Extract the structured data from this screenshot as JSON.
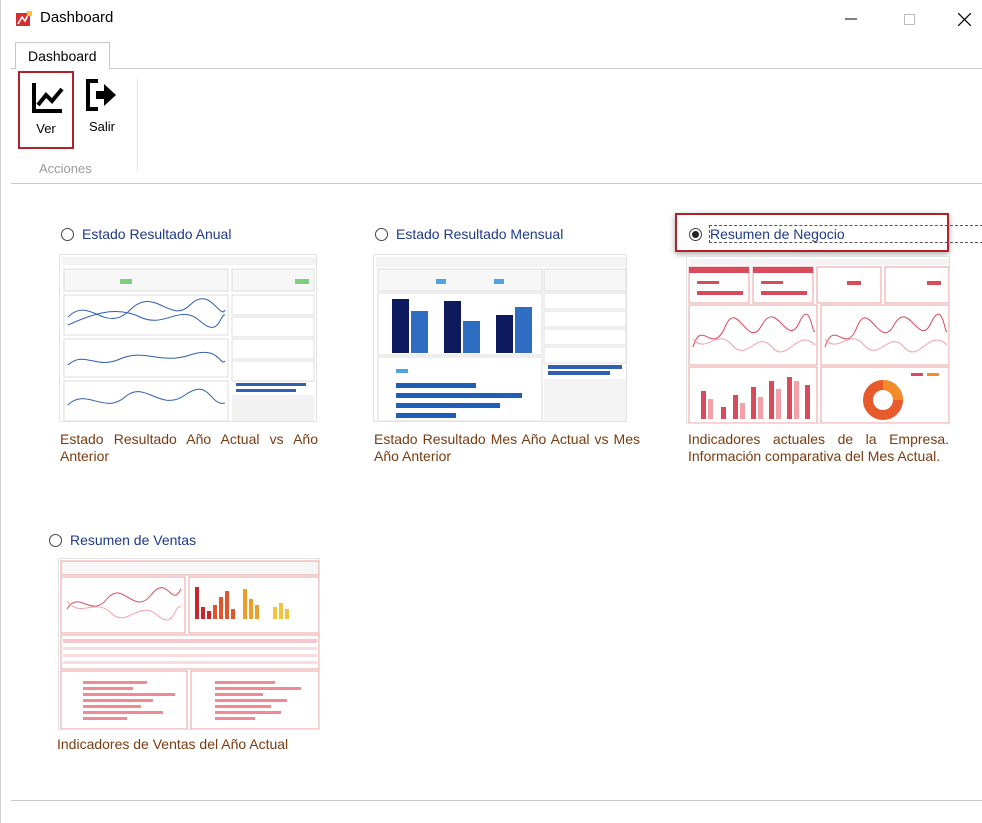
{
  "window": {
    "title": "Dashboard"
  },
  "tabs": [
    {
      "label": "Dashboard"
    }
  ],
  "ribbon": {
    "buttons": [
      {
        "label": "Ver",
        "icon": "chart-line-icon"
      },
      {
        "label": "Salir",
        "icon": "exit-icon"
      }
    ],
    "group_label": "Acciones"
  },
  "options": [
    {
      "label": "Estado Resultado Anual",
      "selected": false,
      "description": "Estado Resultado Año Actual vs Año Anterior"
    },
    {
      "label": "Estado Resultado Mensual",
      "selected": false,
      "description": "Estado Resultado Mes Año Actual vs Mes Año Anterior"
    },
    {
      "label": "Resumen de Negocio",
      "selected": true,
      "description": "Indicadores actuales de la Empresa. Información comparativa del Mes Actual."
    },
    {
      "label": "Resumen de Ventas",
      "selected": false,
      "description": "Indicadores de Ventas del Año Actual"
    }
  ],
  "colors": {
    "accent_red": "#b2202a",
    "label_blue": "#1f3a8a",
    "desc_brown": "#7a3b10"
  }
}
